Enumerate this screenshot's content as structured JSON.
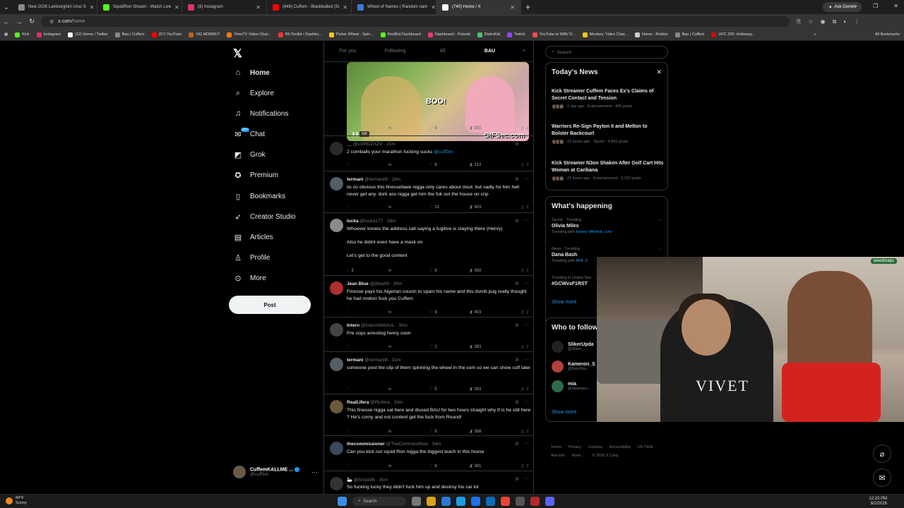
{
  "browser": {
    "tabs": [
      {
        "title": "New 2026 Lamborghini Urus S",
        "color": "#8c8c8c"
      },
      {
        "title": "SquidRon Stream - Watch Live",
        "color": "#53fc18"
      },
      {
        "title": "(8) Instagram",
        "color": "#e1306c"
      },
      {
        "title": "(949) Cuffem - Blackballed (St",
        "color": "#ff0000"
      },
      {
        "title": "Wheel of Names | Random nam",
        "color": "#3a7bd5"
      },
      {
        "title": "(740) Home / X",
        "color": "#ffffff",
        "active": true
      }
    ],
    "new_tab": "+",
    "gemini_label": "Ask Gemini",
    "url_host": "x.com",
    "url_path": "/home",
    "bookmarks": [
      {
        "label": "Kick",
        "color": "#53fc18"
      },
      {
        "label": "Instagram",
        "color": "#e1306c"
      },
      {
        "label": "(12) Home / Twitter",
        "color": "#ffffff"
      },
      {
        "label": "Bau | Cuffem",
        "color": "#888888"
      },
      {
        "label": "(57) YouTube",
        "color": "#ff0000"
      },
      {
        "label": "OG MONKEY",
        "color": "#b5651d"
      },
      {
        "label": "OmeTV Video Chat...",
        "color": "#ff7a00"
      },
      {
        "label": "IRLToolkit • Dashbo...",
        "color": "#e23b3b"
      },
      {
        "label": "Picker Wheel - Spin...",
        "color": "#f5c518"
      },
      {
        "label": "KickBot Dashboard",
        "color": "#53fc18"
      },
      {
        "label": "Dashboard - Pulsoid",
        "color": "#e23b6b"
      },
      {
        "label": "DistroKid",
        "color": "#4cc36b"
      },
      {
        "label": "Twitch",
        "color": "#9146ff"
      },
      {
        "label": "YouTube to WAV D...",
        "color": "#ff4c4c"
      },
      {
        "label": "Monkey: Video Chat...",
        "color": "#f5c518"
      },
      {
        "label": "Home - Roblox",
        "color": "#cccccc"
      },
      {
        "label": "Bau | Cuffem",
        "color": "#888888"
      },
      {
        "label": "UFC 326: Holloway...",
        "color": "#d20a0a"
      }
    ],
    "all_bookmarks": "All Bookmarks"
  },
  "sidebar": {
    "logo": "𝕏",
    "items": [
      {
        "label": "Home",
        "icon": "home-icon",
        "glyph": "⌂"
      },
      {
        "label": "Explore",
        "icon": "search-icon",
        "glyph": "⌕"
      },
      {
        "label": "Notifications",
        "icon": "bell-icon",
        "glyph": "♫"
      },
      {
        "label": "Chat",
        "icon": "chat-icon",
        "glyph": "✉"
      },
      {
        "label": "Grok",
        "icon": "grok-icon",
        "glyph": "◩"
      },
      {
        "label": "Premium",
        "icon": "premium-icon",
        "glyph": "✪"
      },
      {
        "label": "Bookmarks",
        "icon": "bookmark-icon",
        "glyph": "▯"
      },
      {
        "label": "Creator Studio",
        "icon": "rocket-icon",
        "glyph": "➶"
      },
      {
        "label": "Articles",
        "icon": "articles-icon",
        "glyph": "▤"
      },
      {
        "label": "Profile",
        "icon": "profile-icon",
        "glyph": "♙"
      },
      {
        "label": "More",
        "icon": "more-icon",
        "glyph": "⊙"
      }
    ],
    "chat_badge": "20+",
    "post_label": "Post",
    "account_name": "CuffemKALLME ...",
    "account_handle": "@cuff3m"
  },
  "feed": {
    "tabs": [
      "For you",
      "Following",
      "All",
      "BAU"
    ],
    "gif_text": "BOO!",
    "gif_watermark": "GIFSec.com",
    "gif_badge": "GIF",
    "gif_actions": {
      "reply": "",
      "repost": "",
      "like": "5",
      "views": "251"
    },
    "tweets": [
      {
        "name": "__",
        "handle": "@LORDZXZV · 21m",
        "text": "2 cornballs your marathon fucking sucks ",
        "mention": "@cuff3m",
        "reply": "",
        "repost": "",
        "like": "8",
        "views": "213"
      },
      {
        "name": "termani",
        "handle": "@termanilll · 28m",
        "text": "its so obvious this finessefawe nigga only cares about clout. but sadly for him hell never get any. dork ass nigga get him the fuk out the house on crip",
        "mention": "",
        "reply": "",
        "repost": "",
        "like": "12",
        "views": "403"
      },
      {
        "name": "lucka",
        "handle": "@lucka177 · 28m",
        "text": "Whoever knows the address call saying a fugitive is staying there (Henry)\n\nAlso he didint even have a mask on\n\nLet's get to the good content",
        "mention": "",
        "reply": "2",
        "repost": "",
        "like": "8",
        "views": "450"
      },
      {
        "name": "Jean Blue",
        "handle": "@jblue00 · 30m",
        "text": "Finesse pays his Algerian cousin to spam his name and this dumb pug really thought he had motion fuck you Cuffem",
        "mention": "",
        "reply": "",
        "repost": "",
        "like": "8",
        "views": "403"
      },
      {
        "name": "Intern",
        "handle": "@InternWithAnL · 30m",
        "text": "Pre cops arresting henry soon",
        "mention": "",
        "reply": "",
        "repost": "",
        "like": "1",
        "views": "383"
      },
      {
        "name": "termani",
        "handle": "@termanilll · 31m",
        "text": "someone post the clip of them spinning the wheel in the com so we can show cuff later",
        "mention": "",
        "reply": "",
        "repost": "",
        "like": "5",
        "views": "363"
      },
      {
        "name": "RealLifera",
        "handle": "@RLifera · 33m",
        "text": "This finesse nigga sat here and dissed BAU for two hours straight why tf is he still here ? He's corny and not content get the fuck from Round!",
        "mention": "",
        "reply": "",
        "repost": "",
        "like": "6",
        "views": "388"
      },
      {
        "name": "thecommissioner",
        "handle": "@TheCommissi0ner · 34m",
        "text": "Can you kick out squid Ron nigga the biggest leach in this house",
        "mention": "",
        "reply": "",
        "repost": "",
        "like": "8",
        "views": "381"
      },
      {
        "name": "🦢",
        "handle": "@Snick86 · 35m",
        "text": "So fucking lucky they didn't fuck him up and destroy his car lol",
        "mention": "",
        "reply": "",
        "repost": "",
        "like": "",
        "views": ""
      }
    ]
  },
  "right": {
    "search_placeholder": "Search",
    "news_title": "Today's News",
    "news": [
      {
        "title": "Kick Streamer Cuffem Faces Ex's Claims of Secret Contact and Tension",
        "meta": "1 day ago · Entertainment · 405 posts"
      },
      {
        "title": "Warriors Re-Sign Payton II and Melton to Bolster Backcourt",
        "meta": "23 hours ago · Sports · 6,841 posts"
      },
      {
        "title": "Kick Streamer N3on Shaken After Golf Cart Hits Woman at Caribana",
        "meta": "21 hours ago · Entertainment · 2,122 posts"
      }
    ],
    "happening_title": "What's happening",
    "trends": [
      {
        "cat": "Sports · Trending",
        "name": "Olivia Miles",
        "with_label": "Trending with ",
        "with": "Kelsey Mitchell, Lynx"
      },
      {
        "cat": "News · Trending",
        "name": "Dana Bash",
        "with_label": "Trending with ",
        "with": "RFK Jr"
      },
      {
        "cat": "Trending in United Stat",
        "name": "#GCWvsF1RST",
        "with_label": "",
        "with": ""
      }
    ],
    "show_more": "Show more",
    "follow_title": "Who to follow",
    "follow": [
      {
        "name": "SlikerUpda",
        "handle": "@Sliker_..."
      },
      {
        "name": "Kameron_S",
        "handle": "@KamSca..."
      },
      {
        "name": "mia",
        "handle": "@mlamaxx..."
      }
    ],
    "footer": [
      "Terms",
      "Privacy",
      "Cookies",
      "Accessibility",
      "US TIDA",
      "Ads info",
      "More ...",
      "© 2026 X Corp."
    ]
  },
  "webcam": {
    "text": "VIVET",
    "watermark": "weedmaps"
  },
  "taskbar": {
    "temp": "84°F",
    "weather": "Sunny",
    "search": "Search",
    "time": "12:23 PM",
    "date": "8/2/2026"
  }
}
